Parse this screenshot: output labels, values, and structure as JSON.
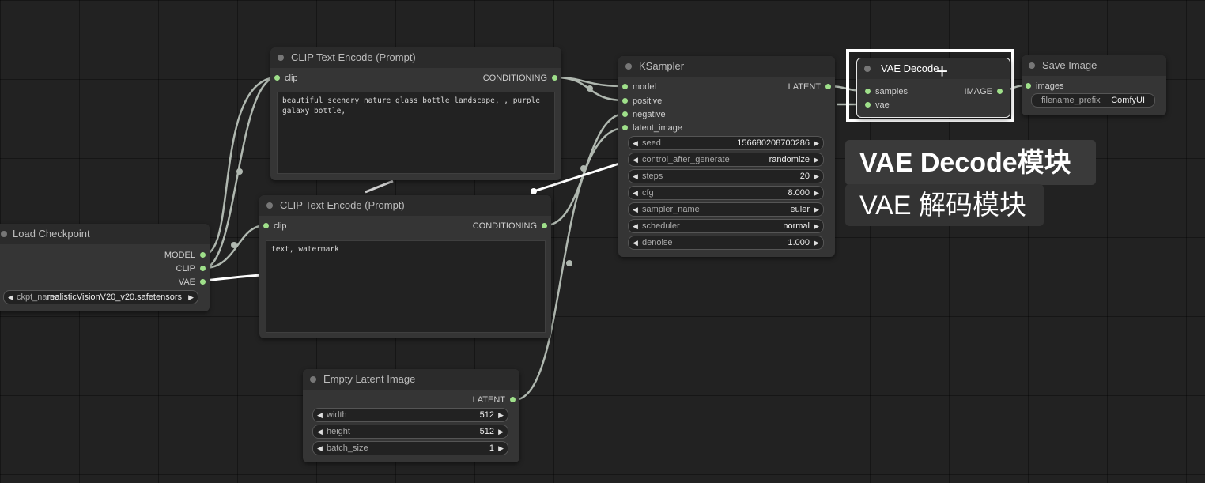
{
  "nodes": {
    "clip_pos": {
      "title": "CLIP Text Encode (Prompt)",
      "input": "clip",
      "output": "CONDITIONING",
      "text": "beautiful scenery nature glass bottle landscape, , purple galaxy bottle,"
    },
    "clip_neg": {
      "title": "CLIP Text Encode (Prompt)",
      "input": "clip",
      "output": "CONDITIONING",
      "text": "text, watermark"
    },
    "load_checkpoint": {
      "title": "Load Checkpoint",
      "outputs": [
        "MODEL",
        "CLIP",
        "VAE"
      ],
      "ckpt_label": "ckpt_name",
      "ckpt_value": "realisticVisionV20_v20.safetensors"
    },
    "ksampler": {
      "title": "KSampler",
      "inputs": [
        "model",
        "positive",
        "negative",
        "latent_image"
      ],
      "output": "LATENT",
      "widgets": [
        {
          "name": "seed",
          "value": "156680208700286"
        },
        {
          "name": "control_after_generate",
          "value": "randomize"
        },
        {
          "name": "steps",
          "value": "20"
        },
        {
          "name": "cfg",
          "value": "8.000"
        },
        {
          "name": "sampler_name",
          "value": "euler"
        },
        {
          "name": "scheduler",
          "value": "normal"
        },
        {
          "name": "denoise",
          "value": "1.000"
        }
      ]
    },
    "vae_decode": {
      "title": "VAE Decode",
      "inputs": [
        "samples",
        "vae"
      ],
      "output": "IMAGE"
    },
    "save_image": {
      "title": "Save Image",
      "input": "images",
      "widget_name": "filename_prefix",
      "widget_value": "ComfyUI"
    },
    "empty_latent": {
      "title": "Empty Latent Image",
      "output": "LATENT",
      "widgets": [
        {
          "name": "width",
          "value": "512"
        },
        {
          "name": "height",
          "value": "512"
        },
        {
          "name": "batch_size",
          "value": "1"
        }
      ]
    }
  },
  "captions": {
    "primary": "VAE Decode模块",
    "secondary": "VAE 解码模块"
  },
  "colors": {
    "background": "#222222",
    "node_body": "#353535",
    "node_title": "#2b2b2b",
    "pin": "#9fe08a",
    "link": "#b0b8b0",
    "selection": "#ffffff"
  },
  "icons": {
    "cursor": "crosshair-plus-icon",
    "left_arrow": "triangle-left-icon",
    "right_arrow": "triangle-right-icon"
  }
}
